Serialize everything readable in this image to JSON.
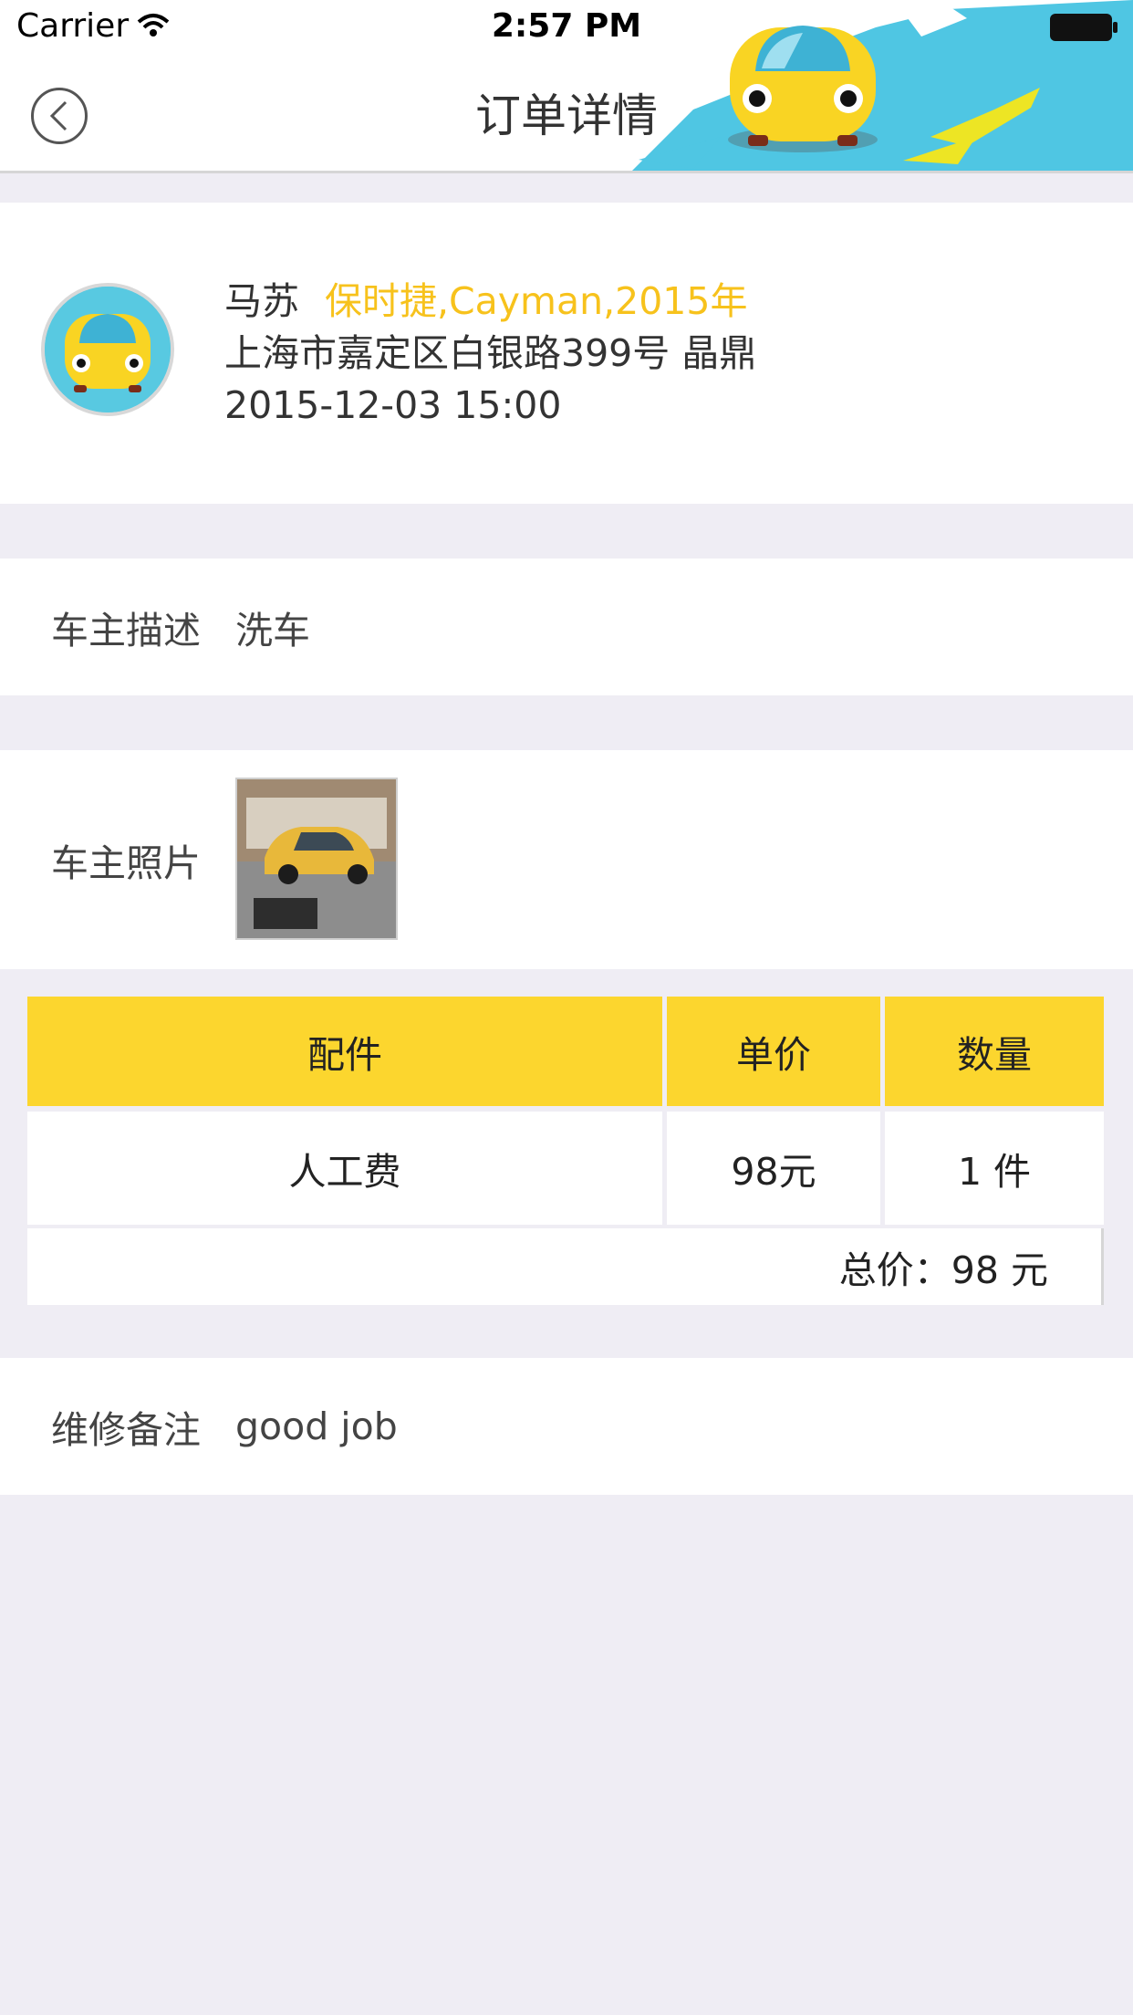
{
  "status_bar": {
    "carrier": "Carrier",
    "time": "2:57 PM"
  },
  "nav": {
    "title": "订单详情"
  },
  "owner": {
    "name": "马苏",
    "car": "保时捷,Cayman,2015年",
    "address": "上海市嘉定区白银路399号 晶鼎",
    "datetime": "2015-12-03 15:00"
  },
  "description": {
    "label": "车主描述",
    "value": "洗车"
  },
  "photos": {
    "label": "车主照片"
  },
  "parts_table": {
    "headers": [
      "配件",
      "单价",
      "数量"
    ],
    "rows": [
      {
        "part": "人工费",
        "price": "98元",
        "qty": "1 件"
      }
    ],
    "total": "总价：98 元"
  },
  "remark": {
    "label": "维修备注",
    "value": "good job"
  },
  "colors": {
    "accent_yellow": "#fcd62e",
    "model_text": "#f7c21c",
    "brush_blue": "#4fc6e3",
    "background": "#efedf4"
  }
}
